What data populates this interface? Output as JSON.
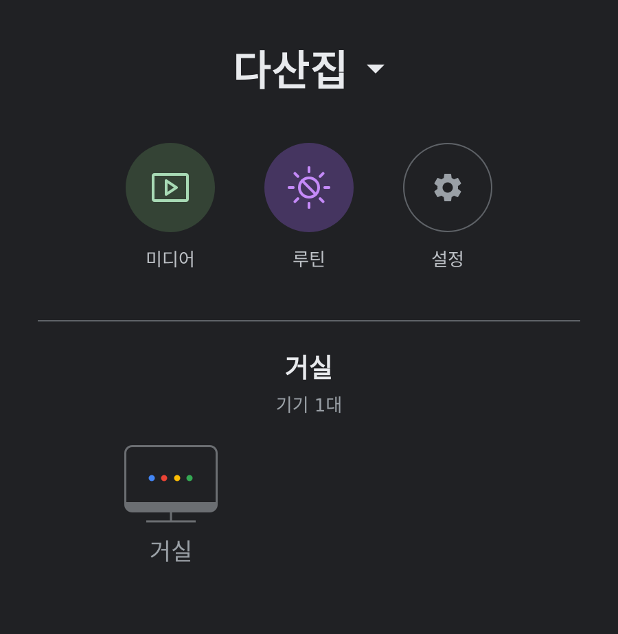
{
  "header": {
    "home_name": "다산집",
    "dropdown_icon": "arrow-drop-down-icon"
  },
  "actions": [
    {
      "label": "미디어",
      "icon": "play-screen-icon",
      "color": "#a8dab5",
      "background": "#344335"
    },
    {
      "label": "루틴",
      "icon": "routine-sun-icon",
      "color": "#c58af9",
      "background": "#453560"
    },
    {
      "label": "설정",
      "icon": "gear-icon",
      "color": "#9aa0a6",
      "background": "transparent"
    }
  ],
  "room": {
    "name": "거실",
    "device_count": "기기 1대"
  },
  "devices": [
    {
      "label": "거실",
      "icon": "smart-display-icon",
      "dot_colors": [
        "#4285f4",
        "#ea4335",
        "#fbbc04",
        "#34a853"
      ]
    }
  ]
}
